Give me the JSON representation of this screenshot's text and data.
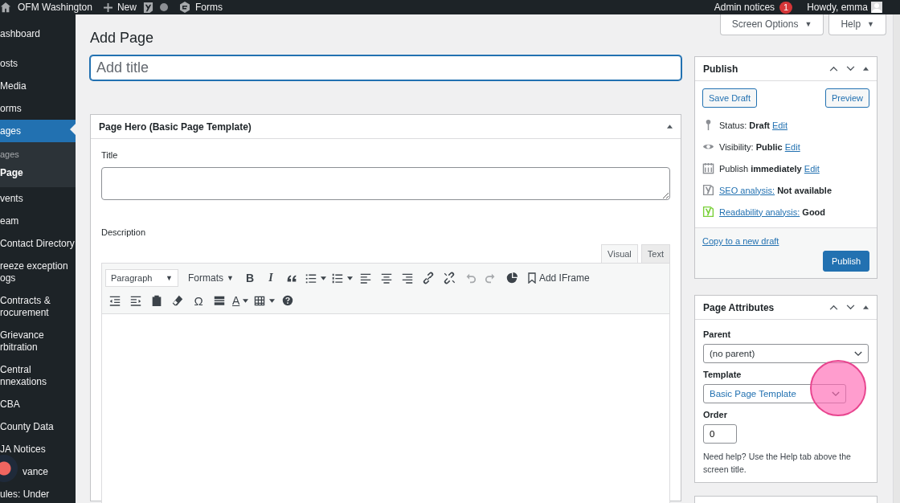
{
  "admin_bar": {
    "site": "OFM Washington",
    "new": "New",
    "forms": "Forms",
    "notices": "Admin notices",
    "notice_count": "1",
    "howdy": "Howdy, emma"
  },
  "sidebar": {
    "items": [
      {
        "label": "ashboard",
        "selected": false
      },
      {
        "label": "osts",
        "selected": false
      },
      {
        "label": "Media",
        "selected": false
      },
      {
        "label": "orms",
        "selected": false
      },
      {
        "label": "ages",
        "selected": true,
        "children": [
          {
            "label": "ages",
            "selected": false
          },
          {
            "label": "Page",
            "selected": true
          }
        ]
      },
      {
        "label": "vents",
        "selected": false
      },
      {
        "label": "eam",
        "selected": false
      },
      {
        "label": "Contact Directory",
        "selected": false
      },
      {
        "label": "reeze exception\nogs",
        "selected": false
      },
      {
        "label": "Contracts &\nrocurement",
        "selected": false
      },
      {
        "label": "Grievance\nrbitration",
        "selected": false
      },
      {
        "label": "Central\nnnexations",
        "selected": false
      },
      {
        "label": "CBA",
        "selected": false
      },
      {
        "label": "County Data",
        "selected": false
      },
      {
        "label": "JA Notices",
        "selected": false
      },
      {
        "label": "vance",
        "selected": false,
        "cursor": true
      },
      {
        "label": "ules: Under",
        "selected": false
      }
    ]
  },
  "screen_options": {
    "label": "Screen Options",
    "caret": "▼"
  },
  "help": {
    "label": "Help",
    "caret": "▼"
  },
  "heading": "Add Page",
  "title_field": {
    "placeholder": "Add title"
  },
  "hero_box": {
    "title": "Page Hero (Basic Page Template)",
    "title_label": "Title",
    "description_label": "Description",
    "editor_tabs": [
      {
        "label": "Visual",
        "selected": true
      },
      {
        "label": "Text",
        "selected": false
      }
    ],
    "format_select": {
      "label": "Paragraph",
      "caret": "▼"
    },
    "formats": {
      "label": "Formats",
      "caret": "▼"
    },
    "iframe": "Add IFrame",
    "toolbar": [
      [
        {
          "kind": "bold",
          "glyph": "B"
        },
        {
          "kind": "italic",
          "glyph": "I"
        },
        {
          "kind": "quote"
        },
        {
          "kind": "bullets",
          "caret": true
        },
        {
          "kind": "numbers",
          "caret": true
        },
        {
          "kind": "align-left"
        },
        {
          "kind": "align-center"
        },
        {
          "kind": "align-right"
        },
        {
          "kind": "link"
        },
        {
          "kind": "unlink"
        },
        {
          "kind": "undo",
          "disabled": true
        },
        {
          "kind": "redo",
          "disabled": true
        },
        {
          "kind": "pie"
        }
      ],
      [
        {
          "kind": "outdent"
        },
        {
          "kind": "indent"
        },
        {
          "kind": "paste"
        },
        {
          "kind": "eraser"
        },
        {
          "kind": "omega",
          "glyph": "Ω"
        },
        {
          "kind": "more"
        },
        {
          "kind": "text-color",
          "glyph": "A",
          "caret": true
        },
        {
          "kind": "table",
          "caret": true
        },
        {
          "kind": "help"
        }
      ]
    ]
  },
  "publish": {
    "title": "Publish",
    "save_draft": "Save Draft",
    "preview": "Preview",
    "rows": [
      {
        "kind": "status",
        "text": "Status: **Draft**",
        "link": "Edit",
        "color": "#8c8f94"
      },
      {
        "kind": "visibility",
        "text": "Visibility: **Public**",
        "link": "Edit",
        "color": "#8c8f94"
      },
      {
        "kind": "schedule",
        "text": "Publish **immediately**",
        "link": "Edit",
        "color": "#8c8f94"
      },
      {
        "kind": "seo",
        "link": "SEO analysis:",
        "text": "**Not available**",
        "color": "#8c8f94"
      },
      {
        "kind": "readability",
        "link": "Readability analysis:",
        "text": "**Good**",
        "color": "#7ad03a"
      }
    ],
    "copy_link": "Copy to a new draft",
    "publish_button": "Publish"
  },
  "attributes": {
    "title": "Page Attributes",
    "parent_label": "Parent",
    "parent_value": "(no parent)",
    "template_label": "Template",
    "template_value": "Basic Page Template",
    "order_label": "Order",
    "order_value": "0",
    "help_text": "Need help? Use the Help tab above the screen title."
  }
}
